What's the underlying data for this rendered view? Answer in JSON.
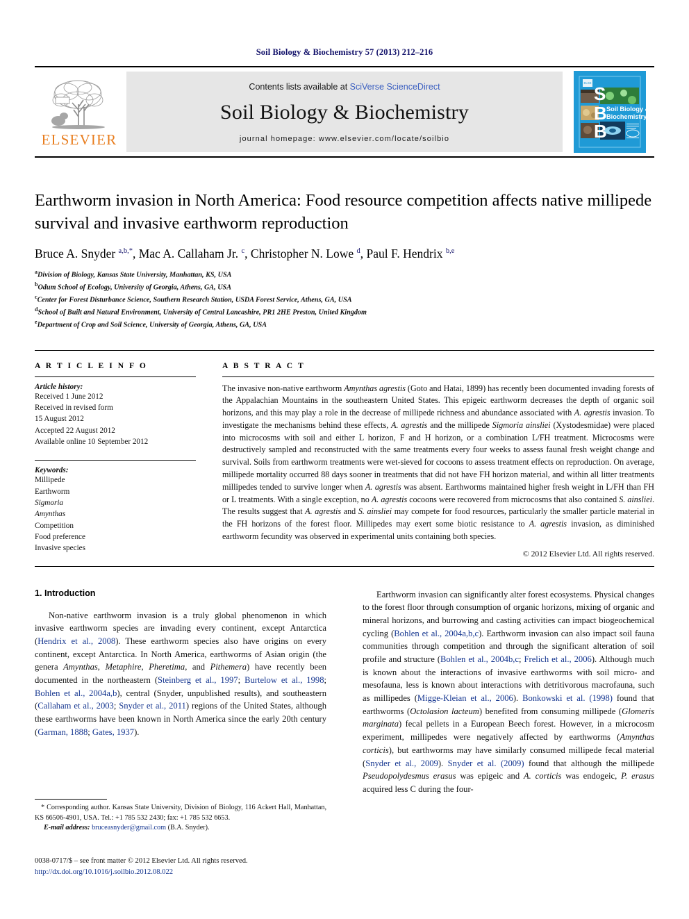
{
  "running_head": "Soil Biology & Biochemistry 57 (2013) 212–216",
  "masthead": {
    "publisher_wordmark": "ELSEVIER",
    "contents_prefix": "Contents lists available at ",
    "contents_link": "SciVerse ScienceDirect",
    "journal_title": "Soil Biology & Biochemistry",
    "homepage": "journal homepage: www.elsevier.com/locate/soilbio",
    "cover_letters": [
      "S",
      "B",
      "B"
    ],
    "cover_title_line1": "Soil Biology &",
    "cover_title_line2": "Biochemistry",
    "cover_bg": "#1F9AD6"
  },
  "article": {
    "title": "Earthworm invasion in North America: Food resource competition affects native millipede survival and invasive earthworm reproduction",
    "authors_html": "Bruce A. Snyder <sup>a,b,*</sup>, Mac A. Callaham Jr. <sup>c</sup>, Christopher N. Lowe <sup>d</sup>, Paul F. Hendrix <sup>b,e</sup>",
    "affiliations": [
      {
        "marker": "a",
        "text": "Division of Biology, Kansas State University, Manhattan, KS, USA"
      },
      {
        "marker": "b",
        "text": "Odum School of Ecology, University of Georgia, Athens, GA, USA"
      },
      {
        "marker": "c",
        "text": "Center for Forest Disturbance Science, Southern Research Station, USDA Forest Service, Athens, GA, USA"
      },
      {
        "marker": "d",
        "text": "School of Built and Natural Environment, University of Central Lancashire, PR1 2HE Preston, United Kingdom"
      },
      {
        "marker": "e",
        "text": "Department of Crop and Soil Science, University of Georgia, Athens, GA, USA"
      }
    ]
  },
  "article_info": {
    "label": "A R T I C L E   I N F O",
    "history_heading": "Article history:",
    "history": [
      "Received 1 June 2012",
      "Received in revised form",
      "15 August 2012",
      "Accepted 22 August 2012",
      "Available online 10 September 2012"
    ],
    "keywords_heading": "Keywords:",
    "keywords": [
      {
        "text": "Millipede",
        "italic": false
      },
      {
        "text": "Earthworm",
        "italic": false
      },
      {
        "text": "Sigmoria",
        "italic": true
      },
      {
        "text": "Amynthas",
        "italic": true
      },
      {
        "text": "Competition",
        "italic": false
      },
      {
        "text": "Food preference",
        "italic": false
      },
      {
        "text": "Invasive species",
        "italic": false
      }
    ]
  },
  "abstract": {
    "label": "A B S T R A C T",
    "html": "The invasive non-native earthworm <i>Amynthas agrestis</i> (Goto and Hatai, 1899) has recently been documented invading forests of the Appalachian Mountains in the southeastern United States. This epigeic earthworm decreases the depth of organic soil horizons, and this may play a role in the decrease of millipede richness and abundance associated with <i>A. agrestis</i> invasion. To investigate the mechanisms behind these effects, <i>A. agrestis</i> and the millipede <i>Sigmoria ainsliei</i> (Xystodesmidae) were placed into microcosms with soil and either L horizon, F and H horizon, or a combination L/FH treatment. Microcosms were destructively sampled and reconstructed with the same treatments every four weeks to assess faunal fresh weight change and survival. Soils from earthworm treatments were wet-sieved for cocoons to assess treatment effects on reproduction. On average, millipede mortality occurred 88 days sooner in treatments that did not have FH horizon material, and within all litter treatments millipedes tended to survive longer when <i>A. agrestis</i> was absent. Earthworms maintained higher fresh weight in L/FH than FH or L treatments. With a single exception, no <i>A. agrestis</i> cocoons were recovered from microcosms that also contained <i>S. ainsliei</i>. The results suggest that <i>A. agrestis</i> and <i>S. ainsliei</i> may compete for food resources, particularly the smaller particle material in the FH horizons of the forest floor. Millipedes may exert some biotic resistance to <i>A. agrestis</i> invasion, as diminished earthworm fecundity was observed in experimental units containing both species.",
    "copyright": "© 2012 Elsevier Ltd. All rights reserved."
  },
  "introduction": {
    "heading": "1.  Introduction",
    "left_paragraph_html": "Non-native earthworm invasion is a truly global phenomenon in which invasive earthworm species are invading every continent, except Antarctica (<span class=\"ref\">Hendrix et al., 2008</span>). These earthworm species also have origins on every continent, except Antarctica. In North America, earthworms of Asian origin (the genera <i>Amynthas</i>, <i>Metaphire</i>, <i>Pheretima</i>, and <i>Pithemera</i>) have recently been documented in the northeastern (<span class=\"ref\">Steinberg et al., 1997</span>; <span class=\"ref\">Burtelow et al., 1998</span>; <span class=\"ref\">Bohlen et al., 2004a,b</span>), central (Snyder, unpublished results), and southeastern (<span class=\"ref\">Callaham et al., 2003</span>; <span class=\"ref\">Snyder et al., 2011</span>) regions of the United States, although these earthworms have been known in North America since the early 20th century (<span class=\"ref\">Garman, 1888</span>; <span class=\"ref\">Gates, 1937</span>).",
    "right_paragraph_html": "Earthworm invasion can significantly alter forest ecosystems. Physical changes to the forest floor through consumption of organic horizons, mixing of organic and mineral horizons, and burrowing and casting activities can impact biogeochemical cycling (<span class=\"ref\">Bohlen et al., 2004a,b,c</span>). Earthworm invasion can also impact soil fauna communities through competition and through the significant alteration of soil profile and structure (<span class=\"ref\">Bohlen et al., 2004b,c</span>; <span class=\"ref\">Frelich et al., 2006</span>). Although much is known about the interactions of invasive earthworms with soil micro- and mesofauna, less is known about interactions with detritivorous macrofauna, such as millipedes (<span class=\"ref\">Migge-Kleian et al., 2006</span>). <span class=\"ref\">Bonkowski et al. (1998)</span> found that earthworms (<i>Octolasion lacteum</i>) benefited from consuming millipede (<i>Glomeris marginata</i>) fecal pellets in a European Beech forest. However, in a microcosm experiment, millipedes were negatively affected by earthworms (<i>Amynthas corticis</i>), but earthworms may have similarly consumed millipede fecal material (<span class=\"ref\">Snyder et al., 2009</span>). <span class=\"ref\">Snyder et al. (2009)</span> found that although the millipede <i>Pseudopolydesmus erasus</i> was epigeic and <i>A. corticis</i> was endogeic, <i>P. erasus</i> acquired less C during the four-"
  },
  "footnote": {
    "corresponding_html": "* Corresponding author. Kansas State University, Division of Biology, 116 Ackert Hall, Manhattan, KS 66506-4901, USA. Tel.: +1 785 532 2430; fax: +1 785 532 6653.",
    "email_label": "E-mail address:",
    "email": "bruceasnyder@gmail.com",
    "email_suffix": "(B.A. Snyder)."
  },
  "imprint": {
    "line1": "0038-0717/$ – see front matter © 2012 Elsevier Ltd. All rights reserved.",
    "doi": "http://dx.doi.org/10.1016/j.soilbio.2012.08.022"
  }
}
